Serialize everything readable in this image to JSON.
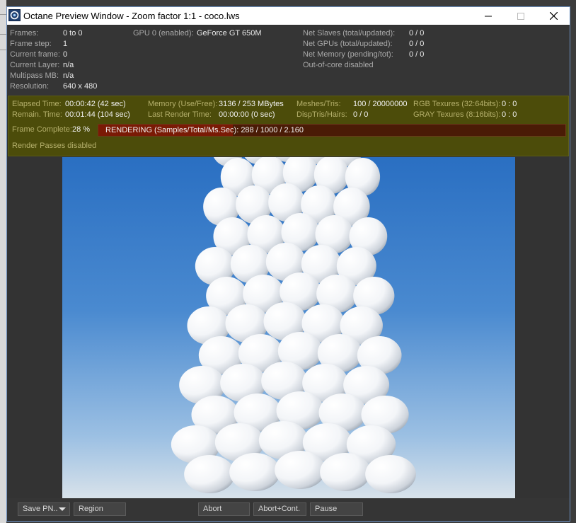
{
  "window": {
    "title": "Octane Preview Window - Zoom factor 1:1 - coco.lws"
  },
  "info": {
    "frames_label": "Frames:",
    "frames_value": "0 to 0",
    "frame_step_label": "Frame step:",
    "frame_step_value": "1",
    "current_frame_label": "Current frame:",
    "current_frame_value": "0",
    "current_layer_label": "Current Layer:",
    "current_layer_value": "n/a",
    "multipass_label": "Multipass MB:",
    "multipass_value": "n/a",
    "resolution_label": "Resolution:",
    "resolution_value": "640 x 480",
    "gpu_label": "GPU  0 (enabled):",
    "gpu_value": "GeForce GT 650M",
    "net_slaves_label": "Net Slaves (total/updated):",
    "net_slaves_value": "0 / 0",
    "net_gpus_label": "Net GPUs (total/updated):",
    "net_gpus_value": "0 / 0",
    "net_memory_label": "Net Memory (pending/tot):",
    "net_memory_value": "0 / 0",
    "out_of_core": "Out-of-core disabled"
  },
  "status": {
    "elapsed_label": "Elapsed Time:",
    "elapsed_value": "00:00:42 (42 sec)",
    "remain_label": "Remain. Time:",
    "remain_value": "00:01:44 (104 sec)",
    "memory_label": "Memory (Use/Free):",
    "memory_value": "3136 / 253 MBytes",
    "last_render_label": "Last Render Time:",
    "last_render_value": "00:00:00 (0 sec)",
    "meshes_label": "Meshes/Tris:",
    "meshes_value": "100 / 20000000",
    "disptris_label": "DispTris/Hairs:",
    "disptris_value": "0 / 0",
    "rgb_label": "RGB Texures (32:64bits):",
    "rgb_value": "0 : 0",
    "gray_label": "GRAY Texures (8:16bits):",
    "gray_value": "0 : 0",
    "frame_complete_label": "Frame Complete:",
    "frame_complete_value": "28 %",
    "rendering_text": "RENDERING (Samples/Total/Ms.Sec): 288 / 1000 / 2.160",
    "progress_fraction": 0.288,
    "render_passes": "Render Passes disabled"
  },
  "toolbar": {
    "save_label": "Save PN..",
    "region_label": "Region",
    "abort_label": "Abort",
    "abort_cont_label": "Abort+Cont.",
    "pause_label": "Pause"
  },
  "colors": {
    "status_bg": "#4c4c0a",
    "progress_bg": "#4a1b06",
    "progress_fill": "#7a1a05",
    "sky_top": "#2a6fc2"
  }
}
